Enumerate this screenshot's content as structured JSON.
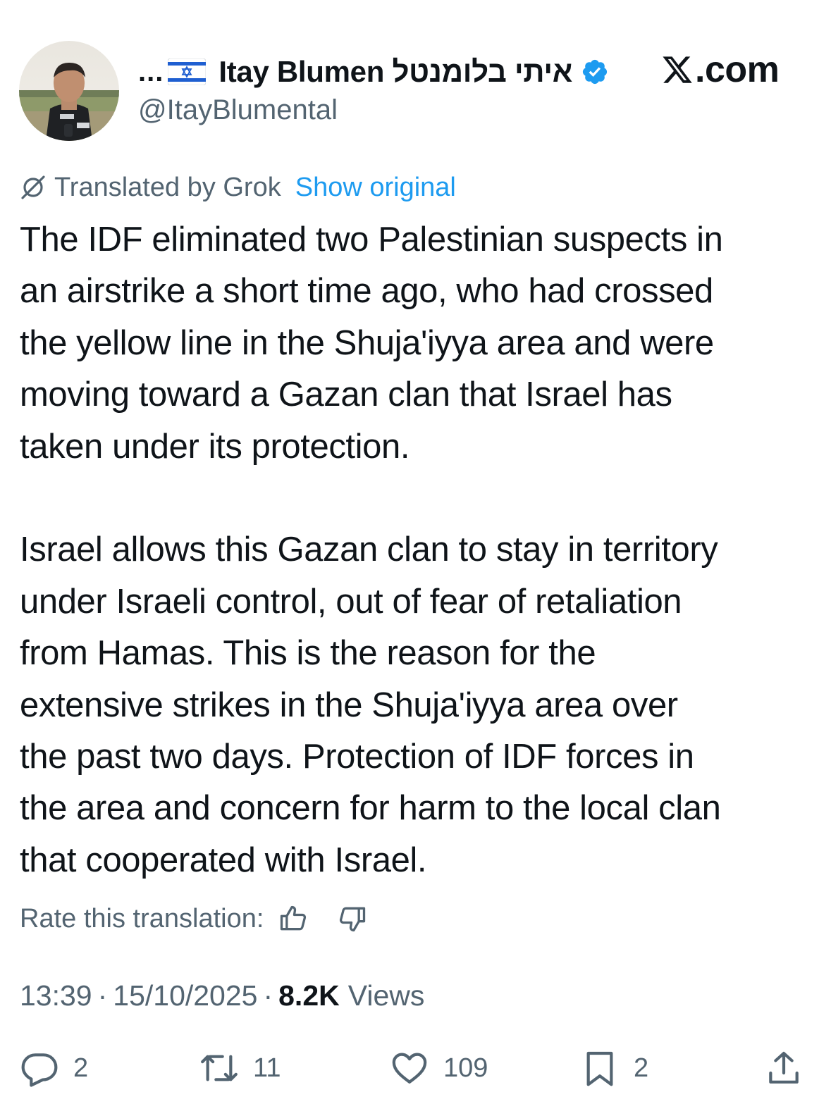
{
  "author": {
    "ellipsis": "...",
    "display_name": "Itay Blumen איתי בלומנטל",
    "handle": "@ItayBlumental",
    "verified": true,
    "flag": "israel-flag-icon",
    "avatar": "profile-photo"
  },
  "source": {
    "site_label": ".com",
    "logo_icon": "x-logo-icon"
  },
  "translation": {
    "label": "Translated by Grok",
    "show_original": "Show original",
    "icon": "grok-icon"
  },
  "tweet": {
    "paragraph1": "The IDF eliminated two Palestinian suspects in\nan airstrike a short time ago, who had crossed\nthe yellow line in the Shuja'iyya area and were\nmoving toward a Gazan clan that Israel has\ntaken under its protection.",
    "paragraph2": "Israel allows this Gazan clan to stay in territory\nunder Israeli control, out of fear of retaliation\nfrom Hamas. This is the reason for the\nextensive strikes in the Shuja'iyya area over\nthe past two days. Protection of IDF forces in\nthe area and concern for harm to the local clan\nthat cooperated with Israel."
  },
  "rating": {
    "label": "Rate this translation:",
    "up_icon": "thumbs-up-icon",
    "down_icon": "thumbs-down-icon"
  },
  "meta": {
    "time": "13:39",
    "date": "15/10/2025",
    "separator": "·",
    "views_count": "8.2K",
    "views_label": "Views"
  },
  "actions": {
    "replies": "2",
    "reposts": "11",
    "likes": "109",
    "bookmarks": "2"
  },
  "colors": {
    "text": "#0f1419",
    "secondary": "#536471",
    "accent": "#1d9bf0"
  }
}
